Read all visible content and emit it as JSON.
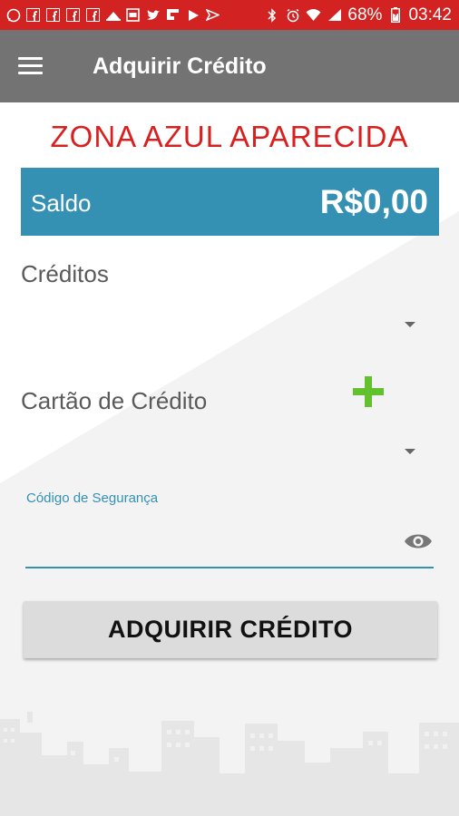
{
  "status_bar": {
    "notification_icons": [
      "whatsapp-icon",
      "facebook-icon",
      "facebook-icon",
      "facebook-icon",
      "facebook-icon",
      "fire-icon",
      "image-icon",
      "twitter-icon",
      "flipboard-icon",
      "play-icon",
      "send-icon"
    ],
    "battery_percent": "68%",
    "time": "03:42"
  },
  "app_bar": {
    "title": "Adquirir Crédito",
    "menu_icon": "hamburger-menu-icon"
  },
  "brand": "ZONA AZUL APARECIDA",
  "balance": {
    "label": "Saldo",
    "value": "R$0,00"
  },
  "form": {
    "credits_label": "Créditos",
    "credit_card_label": "Cartão de Crédito",
    "security_code": {
      "label": "Código de Segurança",
      "value": ""
    }
  },
  "button": {
    "label": "ADQUIRIR CRÉDITO"
  },
  "colors": {
    "status_bar": "#d32222",
    "app_bar": "#737373",
    "brand_text": "#d82020",
    "balance_bg": "#3591b4",
    "add_icon": "#62c12d"
  }
}
